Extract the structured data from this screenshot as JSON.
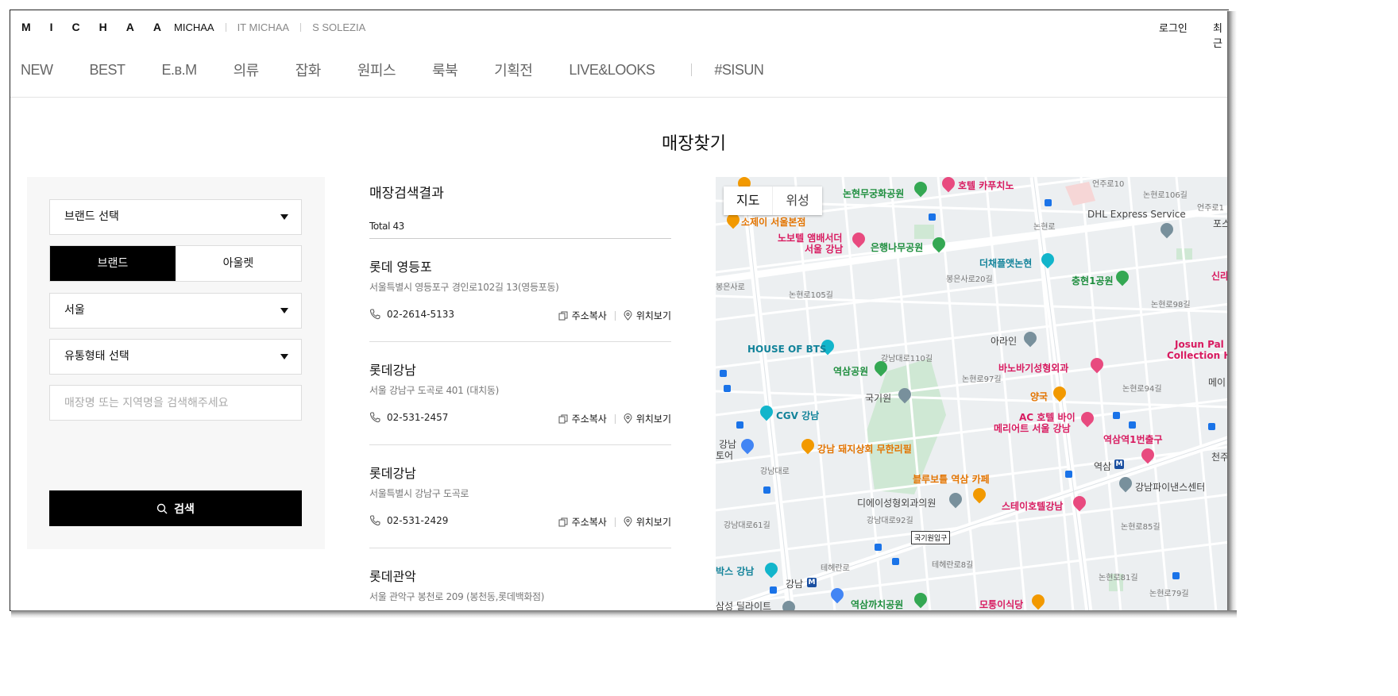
{
  "header": {
    "logo": "MICHAA",
    "brands": [
      "MICHAA",
      "IT MICHAA",
      "S SOLEZIA"
    ],
    "login": "로그인",
    "recent": "최근"
  },
  "gnb": [
    "NEW",
    "BEST",
    "E.в.M",
    "의류",
    "잡화",
    "원피스",
    "룩북",
    "기획전",
    "LIVE&LOOKS",
    "#SISUN"
  ],
  "page_title": "매장찾기",
  "filter": {
    "brand_select": "브랜드 선택",
    "toggle": [
      "브랜드",
      "아울렛"
    ],
    "region_select": "서울",
    "type_select": "유통형태 선택",
    "search_placeholder": "매장명 또는 지역명을 검색해주세요",
    "search_button": "검색"
  },
  "results": {
    "heading": "매장검색결과",
    "total": "Total 43",
    "copy_label": "주소복사",
    "map_label": "위치보기",
    "stores": [
      {
        "name": "롯데 영등포",
        "address": "서울특별시 영등포구 경인로102길 13(영등포동)",
        "phone": "02-2614-5133"
      },
      {
        "name": "롯데강남",
        "address": "서울 강남구 도곡로 401 (대치동)",
        "phone": "02-531-2457"
      },
      {
        "name": "롯데강남",
        "address": "서울특별시 강남구 도곡로",
        "phone": "02-531-2429"
      },
      {
        "name": "롯데관악",
        "address": "서울 관악구 봉천로 209 (봉천동,롯데백화점)",
        "phone": ""
      }
    ]
  },
  "map": {
    "tabs": [
      "지도",
      "위성"
    ],
    "labels": {
      "l1": "논현무궁화공원",
      "l2": "호텔 카푸치노",
      "l3": "소제이 서울본점",
      "l4": "노보텔 앰배서더",
      "l5": "서울 강남",
      "l6": "은행나무공원",
      "l7": "더채플앳논현",
      "l8": "충현1공원",
      "l9": "DHL Express Service",
      "l10": "HOUSE OF BTS",
      "l11": "역삼공원",
      "l12": "국기원",
      "l13": "아라인",
      "l14": "바노바기성형외과",
      "l15": "양국",
      "l16": "CGV 강남",
      "l17": "AC 호텔 바이",
      "l18": "메리어트 서울 강남",
      "l19": "역삼역1번출구",
      "l20": "강남 돼지상회 무한리필",
      "l21": "블루보틀 역삼 카페",
      "l22": "역삼",
      "l23": "강남파이낸스센터",
      "l24": "디에이성형외과의원",
      "l25": "스테이호텔강남",
      "l26": "국기원입구",
      "l27": "강남",
      "l28": "모퉁이식당",
      "l29": "역삼까치공원",
      "l30": "삼성 딜라이트",
      "l31": "박스 강남",
      "l32": "Josun Pal",
      "l33": "Collection H",
      "l34": "신라",
      "l35": "테헤란로",
      "l36": "강남대로",
      "l37": "논현로",
      "l38": "봉은사로",
      "l39": "강남대로110길",
      "l40": "논현로97길",
      "l41": "논현로94길",
      "l42": "강남대로92길",
      "l43": "강남",
      "l44": "토어",
      "l45": "천주",
      "l46": "메이",
      "l47": "언주로10",
      "l48": "논현로106길",
      "l49": "언주로1",
      "l50": "포스",
      "l51": "논현로98길",
      "l52": "논현로85길",
      "l53": "논현로81길",
      "l54": "논현로79길",
      "l55": "테헤란로8길",
      "l56": "봉은사로20길",
      "l57": "논현로105길",
      "l58": "강남대로61길"
    }
  },
  "colors": {
    "accent": "#000000",
    "map_green": "#1e8e3e",
    "map_pink": "#d81b60",
    "map_orange": "#e37400"
  }
}
